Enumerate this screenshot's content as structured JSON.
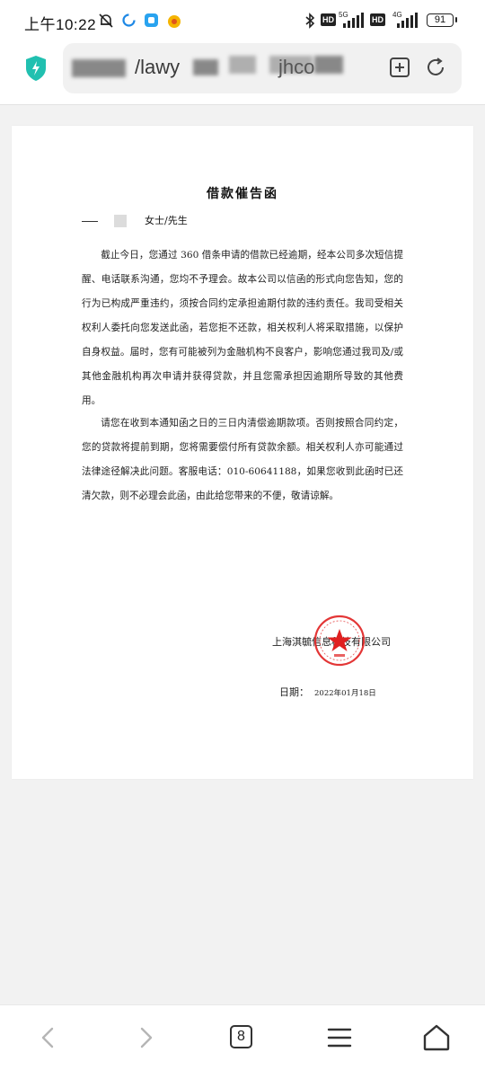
{
  "status_bar": {
    "time": "上午10:22",
    "network_label_1": "5G",
    "network_label_2": "4G",
    "hd_label": "HD",
    "battery": "91"
  },
  "address_bar": {
    "url_visible_fragment": "/lawy",
    "url_tail_fragment": "jhco"
  },
  "letter": {
    "title": "借款催告函",
    "salutation": "女士/先生",
    "paragraph_1": "截止今日，您通过 360 借条申请的借款已经逾期，经本公司多次短信提醒、电话联系沟通，您均不予理会。故本公司以信函的形式向您告知，您的行为已构成严重违约，须按合同约定承担逾期付款的违约责任。我司受相关权利人委托向您发送此函，若您拒不还款，相关权利人将采取措施，以保护自身权益。届时，您有可能被列为金融机构不良客户，影响您通过我司及/或其他金融机构再次申请并获得贷款，并且您需承担因逾期所导致的其他费用。",
    "paragraph_2": "请您在收到本通知函之日的三日内清偿逾期款项。否则按照合同约定，您的贷款将提前到期，您将需要偿付所有贷款余额。相关权利人亦可能通过法律途径解决此问题。客服电话：010-60641188，如果您收到此函时已还清欠款，则不必理会此函，由此给您带来的不便，敬请谅解。",
    "company": "上海淇毓信息科技有限公司",
    "date_label": "日期：",
    "date_value": "2022年01月18日"
  },
  "bottom_nav": {
    "tab_count": "8"
  },
  "colors": {
    "seal_red": "#e02020",
    "shield_teal": "#21c0b0",
    "page_bg": "#f2f2f2"
  }
}
